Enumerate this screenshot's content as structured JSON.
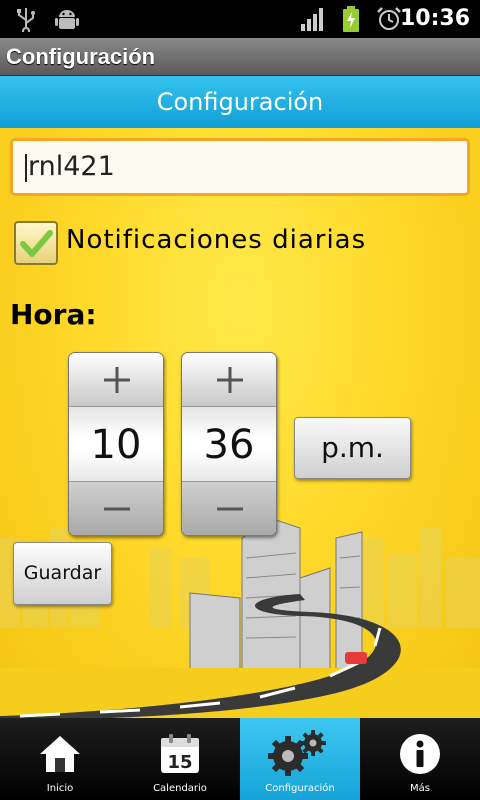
{
  "status_bar": {
    "time": "10:36",
    "icons": [
      "usb-icon",
      "android-debug-icon",
      "signal-icon",
      "battery-charging-icon",
      "alarm-icon"
    ]
  },
  "app_bar": {
    "title": "Configuración"
  },
  "header": {
    "title": "Configuración"
  },
  "form": {
    "plate_value": "rnl421",
    "notifications": {
      "label": "Notificaciones diarias",
      "checked": true
    },
    "hour_label": "Hora:",
    "hour": {
      "value": "10"
    },
    "minute": {
      "value": "36"
    },
    "ampm_label": "p.m.",
    "save_label": "Guardar"
  },
  "tabs": [
    {
      "label": "Inicio",
      "icon": "home-icon",
      "active": false
    },
    {
      "label": "Calendario",
      "icon": "calendar-icon",
      "icon_text": "15",
      "active": false
    },
    {
      "label": "Configuración",
      "icon": "gears-icon",
      "active": true
    },
    {
      "label": "Más",
      "icon": "info-icon",
      "active": false
    }
  ],
  "colors": {
    "accent_blue": "#1aa9de",
    "background_yellow": "#ffd92a",
    "input_border": "#f5a623",
    "check_green": "#7ac943"
  }
}
